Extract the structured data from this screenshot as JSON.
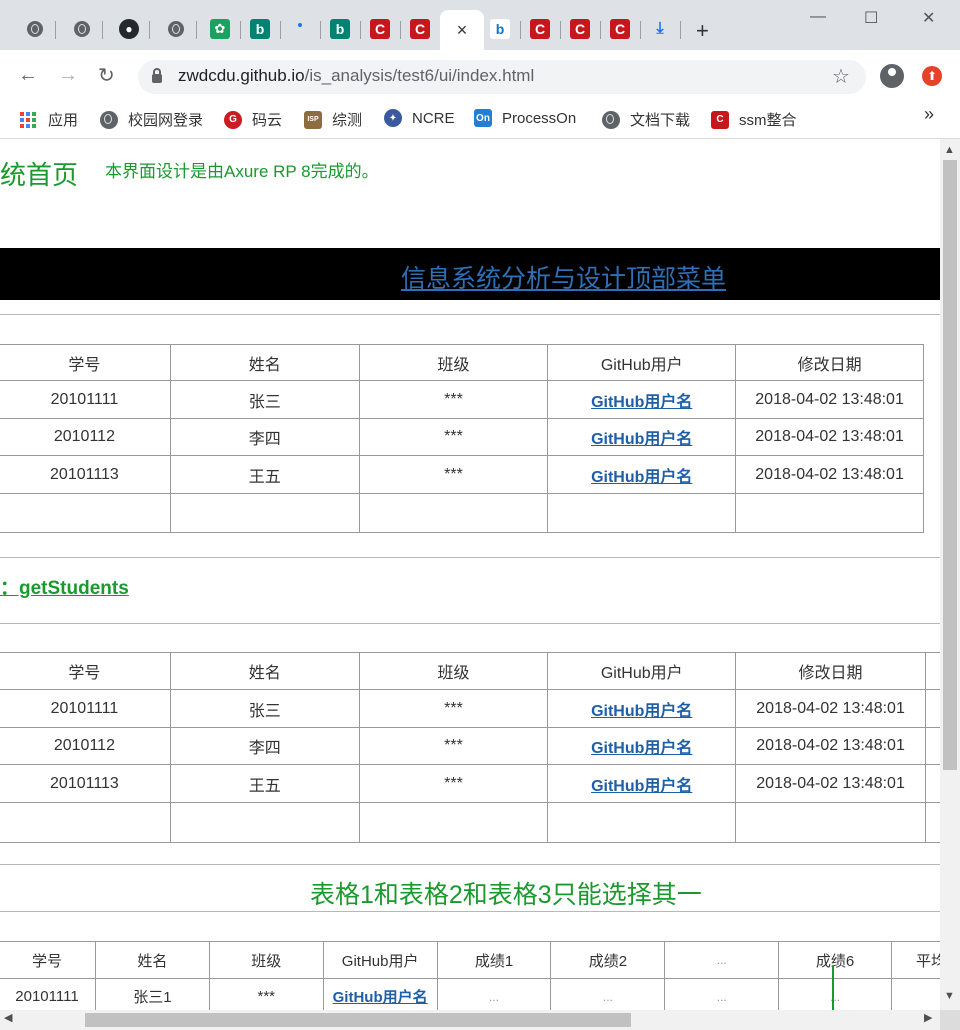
{
  "browser": {
    "tabs": [
      {
        "icon": "globe-icon"
      },
      {
        "icon": "globe-icon"
      },
      {
        "icon": "github-icon"
      },
      {
        "icon": "globe-icon"
      },
      {
        "icon": "green-app-icon"
      },
      {
        "icon": "bing-icon"
      },
      {
        "icon": "dot-icon"
      },
      {
        "icon": "bing-icon"
      },
      {
        "icon": "csdn-icon"
      },
      {
        "icon": "csdn-icon"
      },
      {
        "icon": "close-icon",
        "active": true
      },
      {
        "icon": "bing-blue-icon"
      },
      {
        "icon": "csdn-icon"
      },
      {
        "icon": "csdn-icon"
      },
      {
        "icon": "csdn-icon"
      },
      {
        "icon": "download-icon"
      }
    ],
    "active_tab_close": "×",
    "new_tab": "+",
    "window_controls": {
      "minimize": "—",
      "maximize": "☐",
      "close": "✕"
    },
    "url_host": "zwdcdu.github.io",
    "url_path": "/is_analysis/test6/ui/index.html",
    "bookmarks": [
      {
        "label": "应用",
        "icon": "apps-grid-icon"
      },
      {
        "label": "校园网登录",
        "icon": "globe-icon"
      },
      {
        "label": "码云",
        "icon": "gitee-icon",
        "color": "#c71d23"
      },
      {
        "label": "综测",
        "icon": "isp-icon",
        "color": "#8c6d3f"
      },
      {
        "label": "NCRE",
        "icon": "ncre-icon",
        "color": "#3a5aa0"
      },
      {
        "label": "ProcessOn",
        "icon": "processon-icon",
        "color": "#1f7fd6"
      },
      {
        "label": "文档下载",
        "icon": "globe-icon"
      },
      {
        "label": "ssm整合",
        "icon": "csdn-icon",
        "color": "#c8161d"
      }
    ],
    "bookmarks_more": "»"
  },
  "page": {
    "title_fragment": "统首页",
    "design_note": "本界面设计是由Axure RP 8完成的。",
    "menu_link": "信息系统分析与设计顶部菜单",
    "api_link": "：getStudents",
    "notice": "表格1和表格2和表格3只能选择其一"
  },
  "table1": {
    "headers": [
      "学号",
      "姓名",
      "班级",
      "GitHub用户",
      "修改日期"
    ],
    "rows": [
      [
        "20101111",
        "张三",
        "***",
        "GitHub用户名",
        "2018-04-02 13:48:01"
      ],
      [
        "2010112",
        "李四",
        "***",
        "GitHub用户名",
        "2018-04-02 13:48:01"
      ],
      [
        "20101113",
        "王五",
        "***",
        "GitHub用户名",
        "2018-04-02 13:48:01"
      ],
      [
        "",
        "",
        "",
        "",
        ""
      ]
    ]
  },
  "table2": {
    "headers": [
      "学号",
      "姓名",
      "班级",
      "GitHub用户",
      "修改日期"
    ],
    "rows": [
      [
        "20101111",
        "张三",
        "***",
        "GitHub用户名",
        "2018-04-02 13:48:01"
      ],
      [
        "2010112",
        "李四",
        "***",
        "GitHub用户名",
        "2018-04-02 13:48:01"
      ],
      [
        "20101113",
        "王五",
        "***",
        "GitHub用户名",
        "2018-04-02 13:48:01"
      ],
      [
        "",
        "",
        "",
        "",
        ""
      ]
    ]
  },
  "table3": {
    "headers": [
      "学号",
      "姓名",
      "班级",
      "GitHub用户",
      "成绩1",
      "成绩2",
      "...",
      "成绩6",
      "平均"
    ],
    "rows": [
      [
        "20101111",
        "张三1",
        "***",
        "GitHub用户名",
        "...",
        "...",
        "...",
        "...",
        ""
      ]
    ]
  }
}
